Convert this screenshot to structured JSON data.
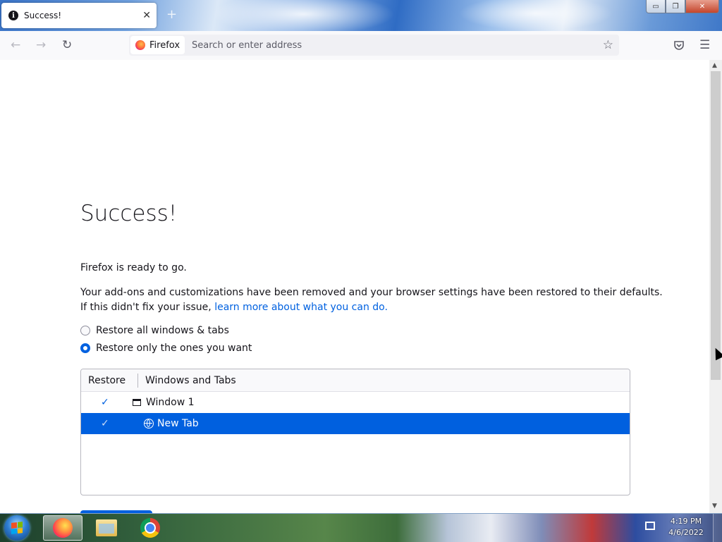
{
  "tab": {
    "title": "Success!"
  },
  "window_controls": {
    "minimize": "▭",
    "restore": "❐",
    "close": "✕"
  },
  "navbar": {
    "identity_label": "Firefox",
    "url_placeholder": "Search or enter address"
  },
  "page": {
    "heading": "Success!",
    "ready_text": "Firefox is ready to go.",
    "description_1": "Your add-ons and customizations have been removed and your browser settings have been restored to their defaults.",
    "description_2_prefix": "If this didn't fix your issue, ",
    "description_2_link": "learn more about what you can do.",
    "radio_all": "Restore all windows & tabs",
    "radio_some": "Restore only the ones you want",
    "tree": {
      "col_restore": "Restore",
      "col_windows": "Windows and Tabs",
      "rows": [
        {
          "label": "Window 1",
          "checked": true,
          "type": "window"
        },
        {
          "label": "New Tab",
          "checked": true,
          "type": "tab",
          "selected": true
        }
      ]
    }
  },
  "taskbar": {
    "time": "4:19 PM",
    "date": "4/6/2022",
    "apps": [
      "firefox",
      "file-explorer",
      "chrome"
    ]
  },
  "colors": {
    "accent": "#0060df",
    "link": "#0061e0"
  }
}
